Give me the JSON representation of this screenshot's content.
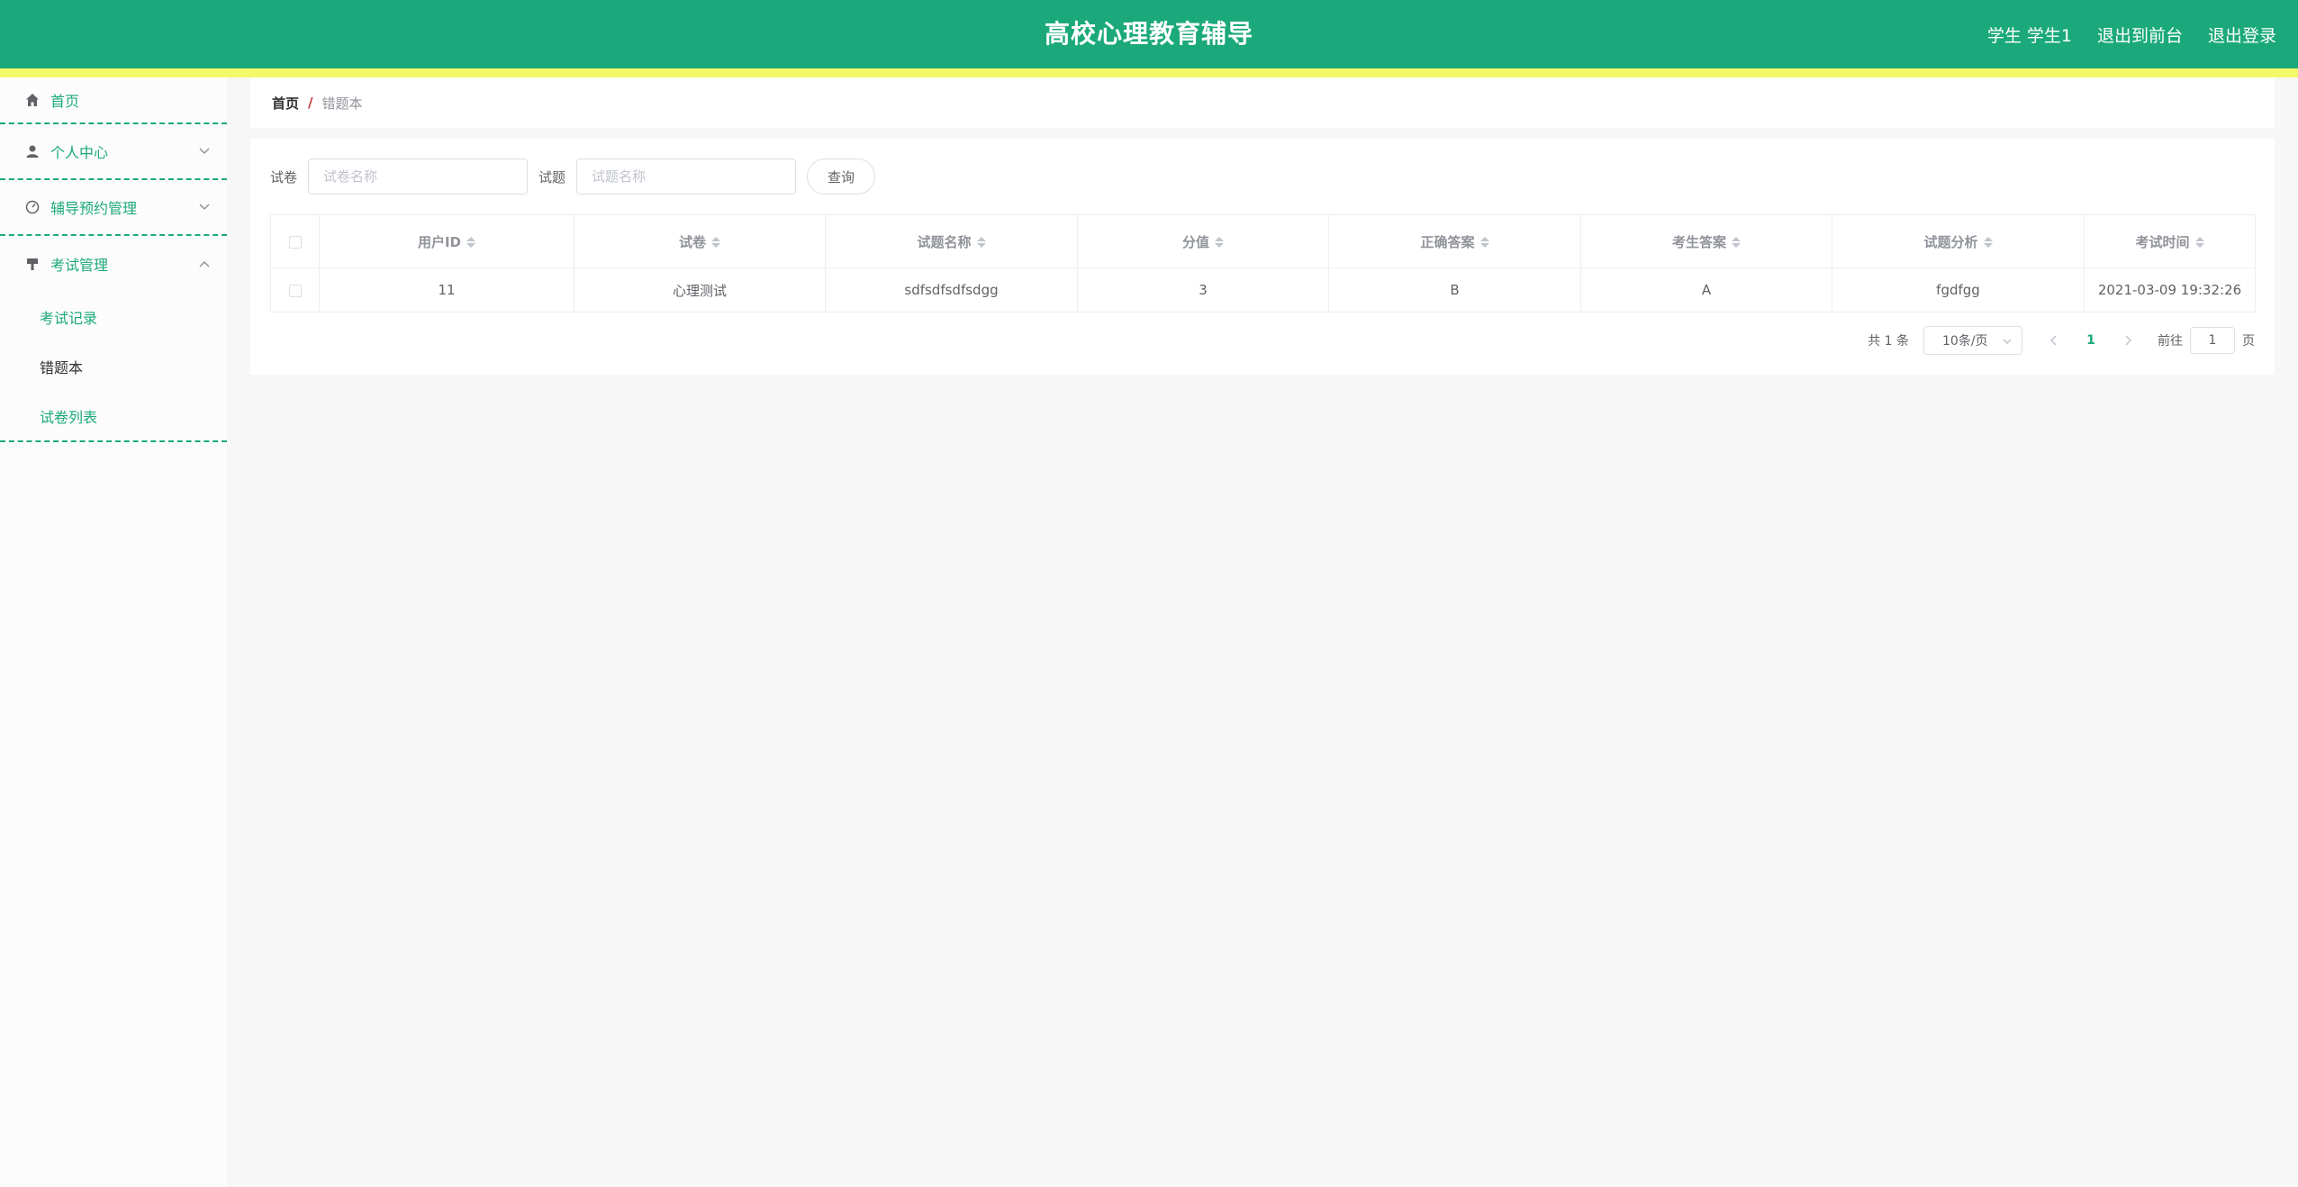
{
  "header": {
    "title": "高校心理教育辅导",
    "user": "学生 学生1",
    "to_frontend": "退出到前台",
    "logout": "退出登录"
  },
  "sidebar": {
    "items": [
      {
        "label": "首页",
        "icon": "home-icon"
      },
      {
        "label": "个人中心",
        "icon": "user-icon"
      },
      {
        "label": "辅导预约管理",
        "icon": "dashboard-icon"
      },
      {
        "label": "考试管理",
        "icon": "exam-icon",
        "children": [
          {
            "label": "考试记录",
            "active": false
          },
          {
            "label": "错题本",
            "active": true
          },
          {
            "label": "试卷列表",
            "active": false
          }
        ]
      }
    ]
  },
  "breadcrumb": {
    "home": "首页",
    "separator": "/",
    "current": "错题本"
  },
  "search": {
    "paper_label": "试卷",
    "paper_placeholder": "试卷名称",
    "question_label": "试题",
    "question_placeholder": "试题名称",
    "button": "查询"
  },
  "table": {
    "columns": [
      "用户ID",
      "试卷",
      "试题名称",
      "分值",
      "正确答案",
      "考生答案",
      "试题分析",
      "考试时间"
    ],
    "rows": [
      [
        "11",
        "心理测试",
        "sdfsdfsdfsdgg",
        "3",
        "B",
        "A",
        "fgdfgg",
        "2021-03-09 19:32:26"
      ]
    ]
  },
  "pagination": {
    "total": "共 1 条",
    "page_size": "10条/页",
    "current_page": "1",
    "goto_prefix": "前往",
    "goto_value": "1",
    "goto_suffix": "页"
  },
  "colors": {
    "primary": "#1ba97b",
    "stripe": "#f2fa6a"
  }
}
